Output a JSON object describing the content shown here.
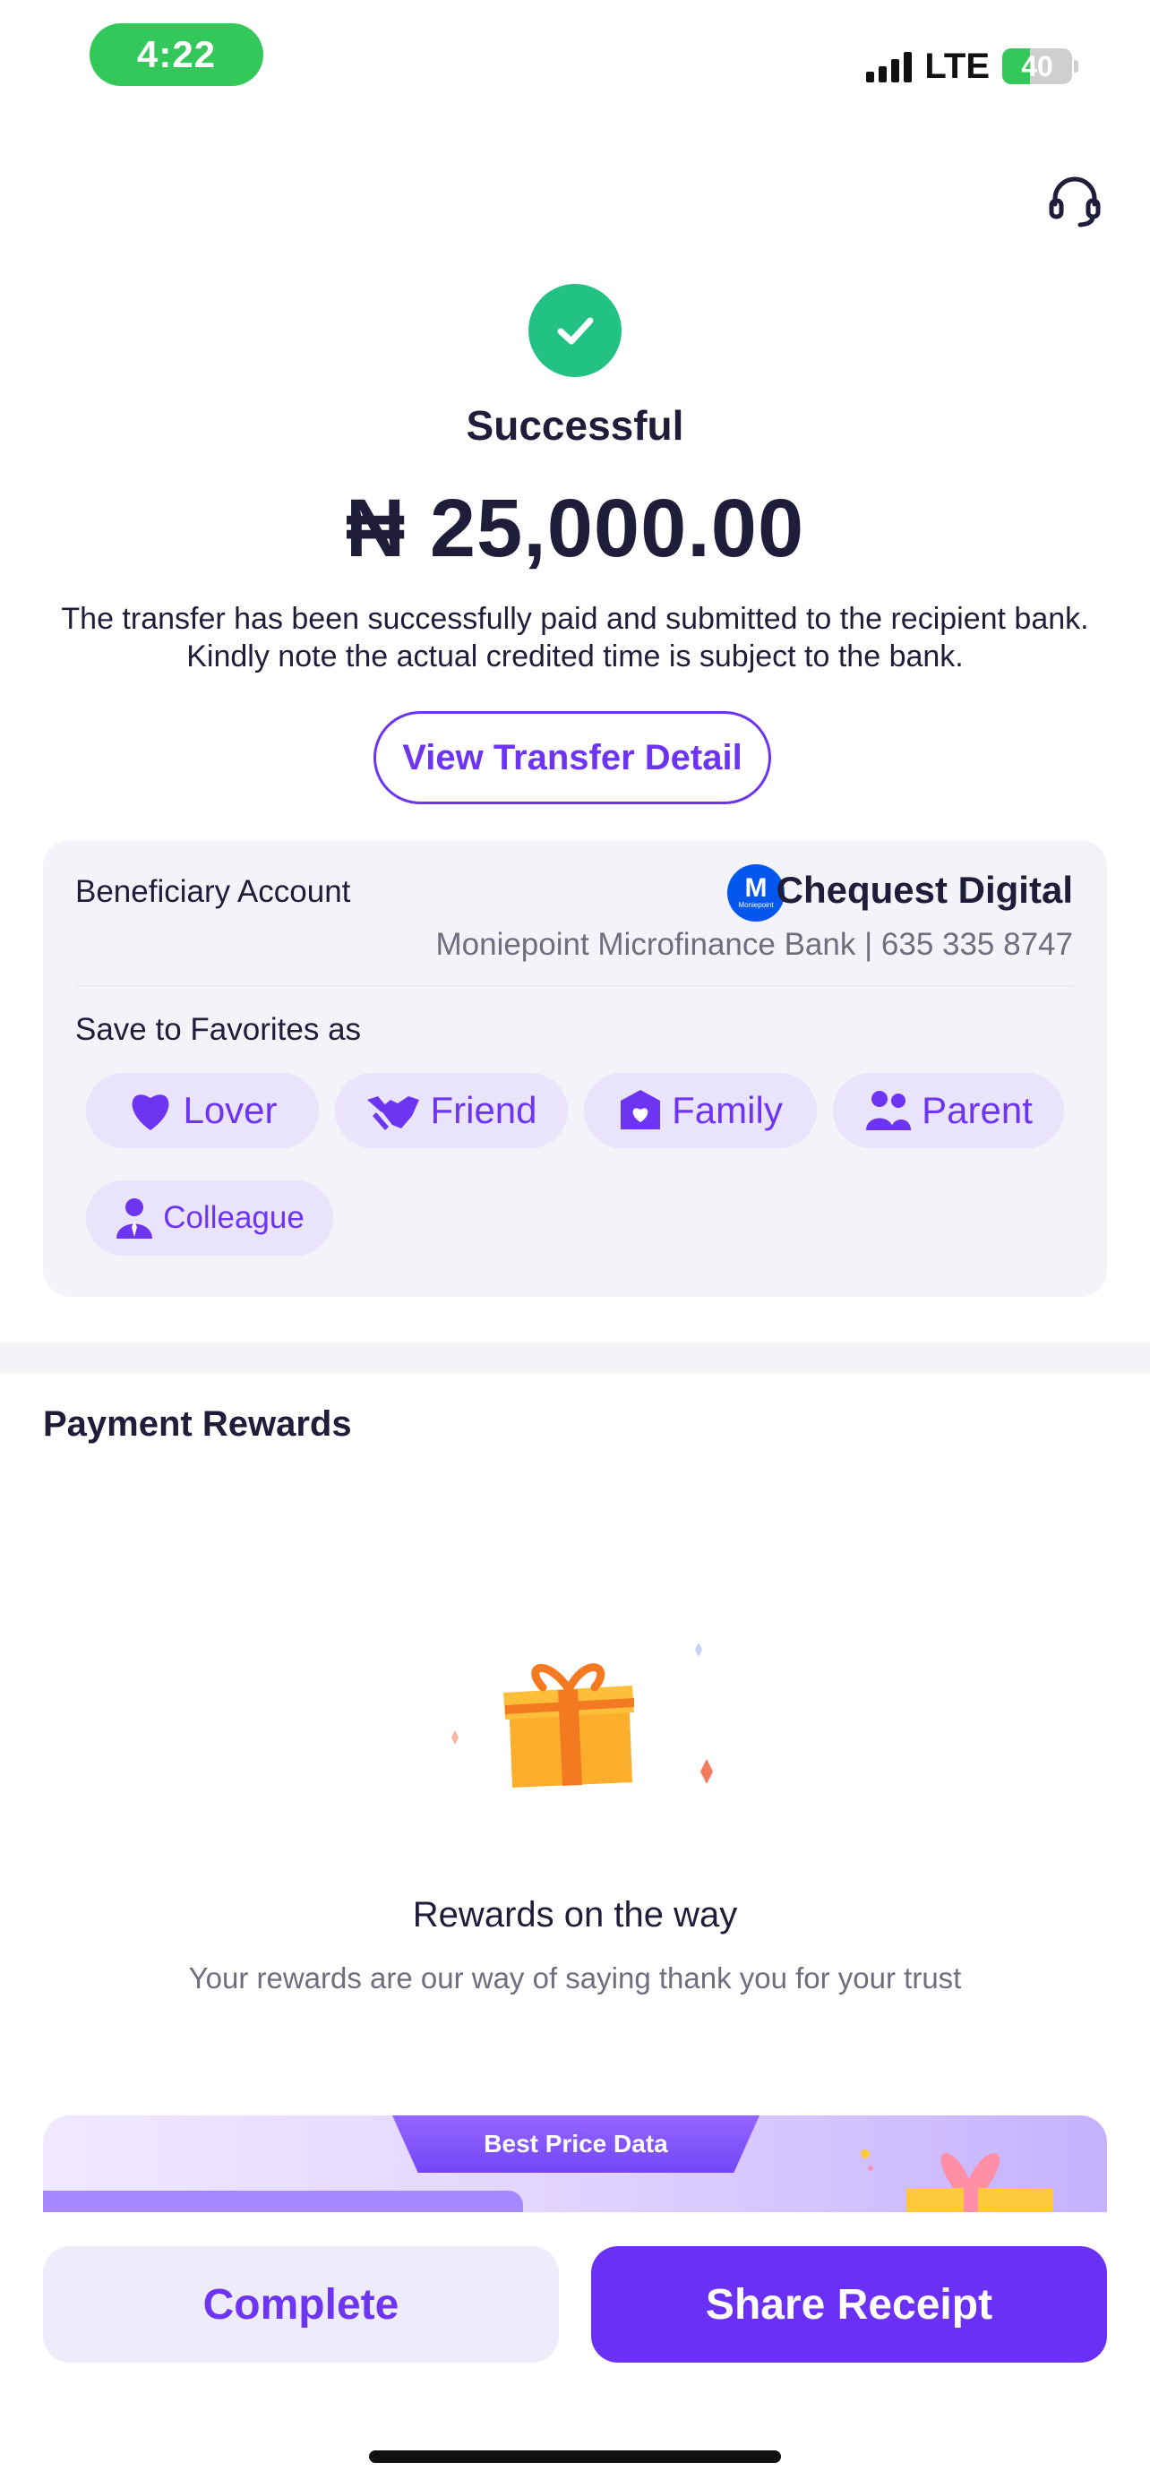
{
  "status_bar": {
    "time": "4:22",
    "network": "LTE",
    "battery": "40",
    "battery_level": 0.4
  },
  "header": {
    "support_icon": "headset-icon"
  },
  "result": {
    "status_icon": "check-icon",
    "title": "Successful",
    "amount": "₦ 25,000.00",
    "message": "The transfer has been successfully paid and submitted to the recipient bank. Kindly note the actual credited time is subject to the bank.",
    "view_detail_label": "View Transfer Detail"
  },
  "beneficiary": {
    "label": "Beneficiary Account",
    "logo_letter": "M",
    "logo_subtext": "Moniepoint",
    "name": "Chequest Digital",
    "bank_details": "Moniepoint Microfinance Bank | 635 335 8747"
  },
  "favorites": {
    "label": "Save to Favorites as",
    "chips": [
      {
        "label": "Lover",
        "icon": "heart-icon"
      },
      {
        "label": "Friend",
        "icon": "handshake-icon"
      },
      {
        "label": "Family",
        "icon": "home-heart-icon"
      },
      {
        "label": "Parent",
        "icon": "people-icon"
      },
      {
        "label": "Colleague",
        "icon": "person-tie-icon"
      }
    ]
  },
  "rewards": {
    "section_title": "Payment Rewards",
    "heading": "Rewards on the way",
    "subtitle": "Your rewards are our way of saying thank you for your trust"
  },
  "promo": {
    "tab_label": "Best Price Data"
  },
  "actions": {
    "complete_label": "Complete",
    "share_label": "Share Receipt"
  },
  "colors": {
    "accent": "#6d35f2",
    "success": "#22c285",
    "status_green": "#34c759"
  }
}
